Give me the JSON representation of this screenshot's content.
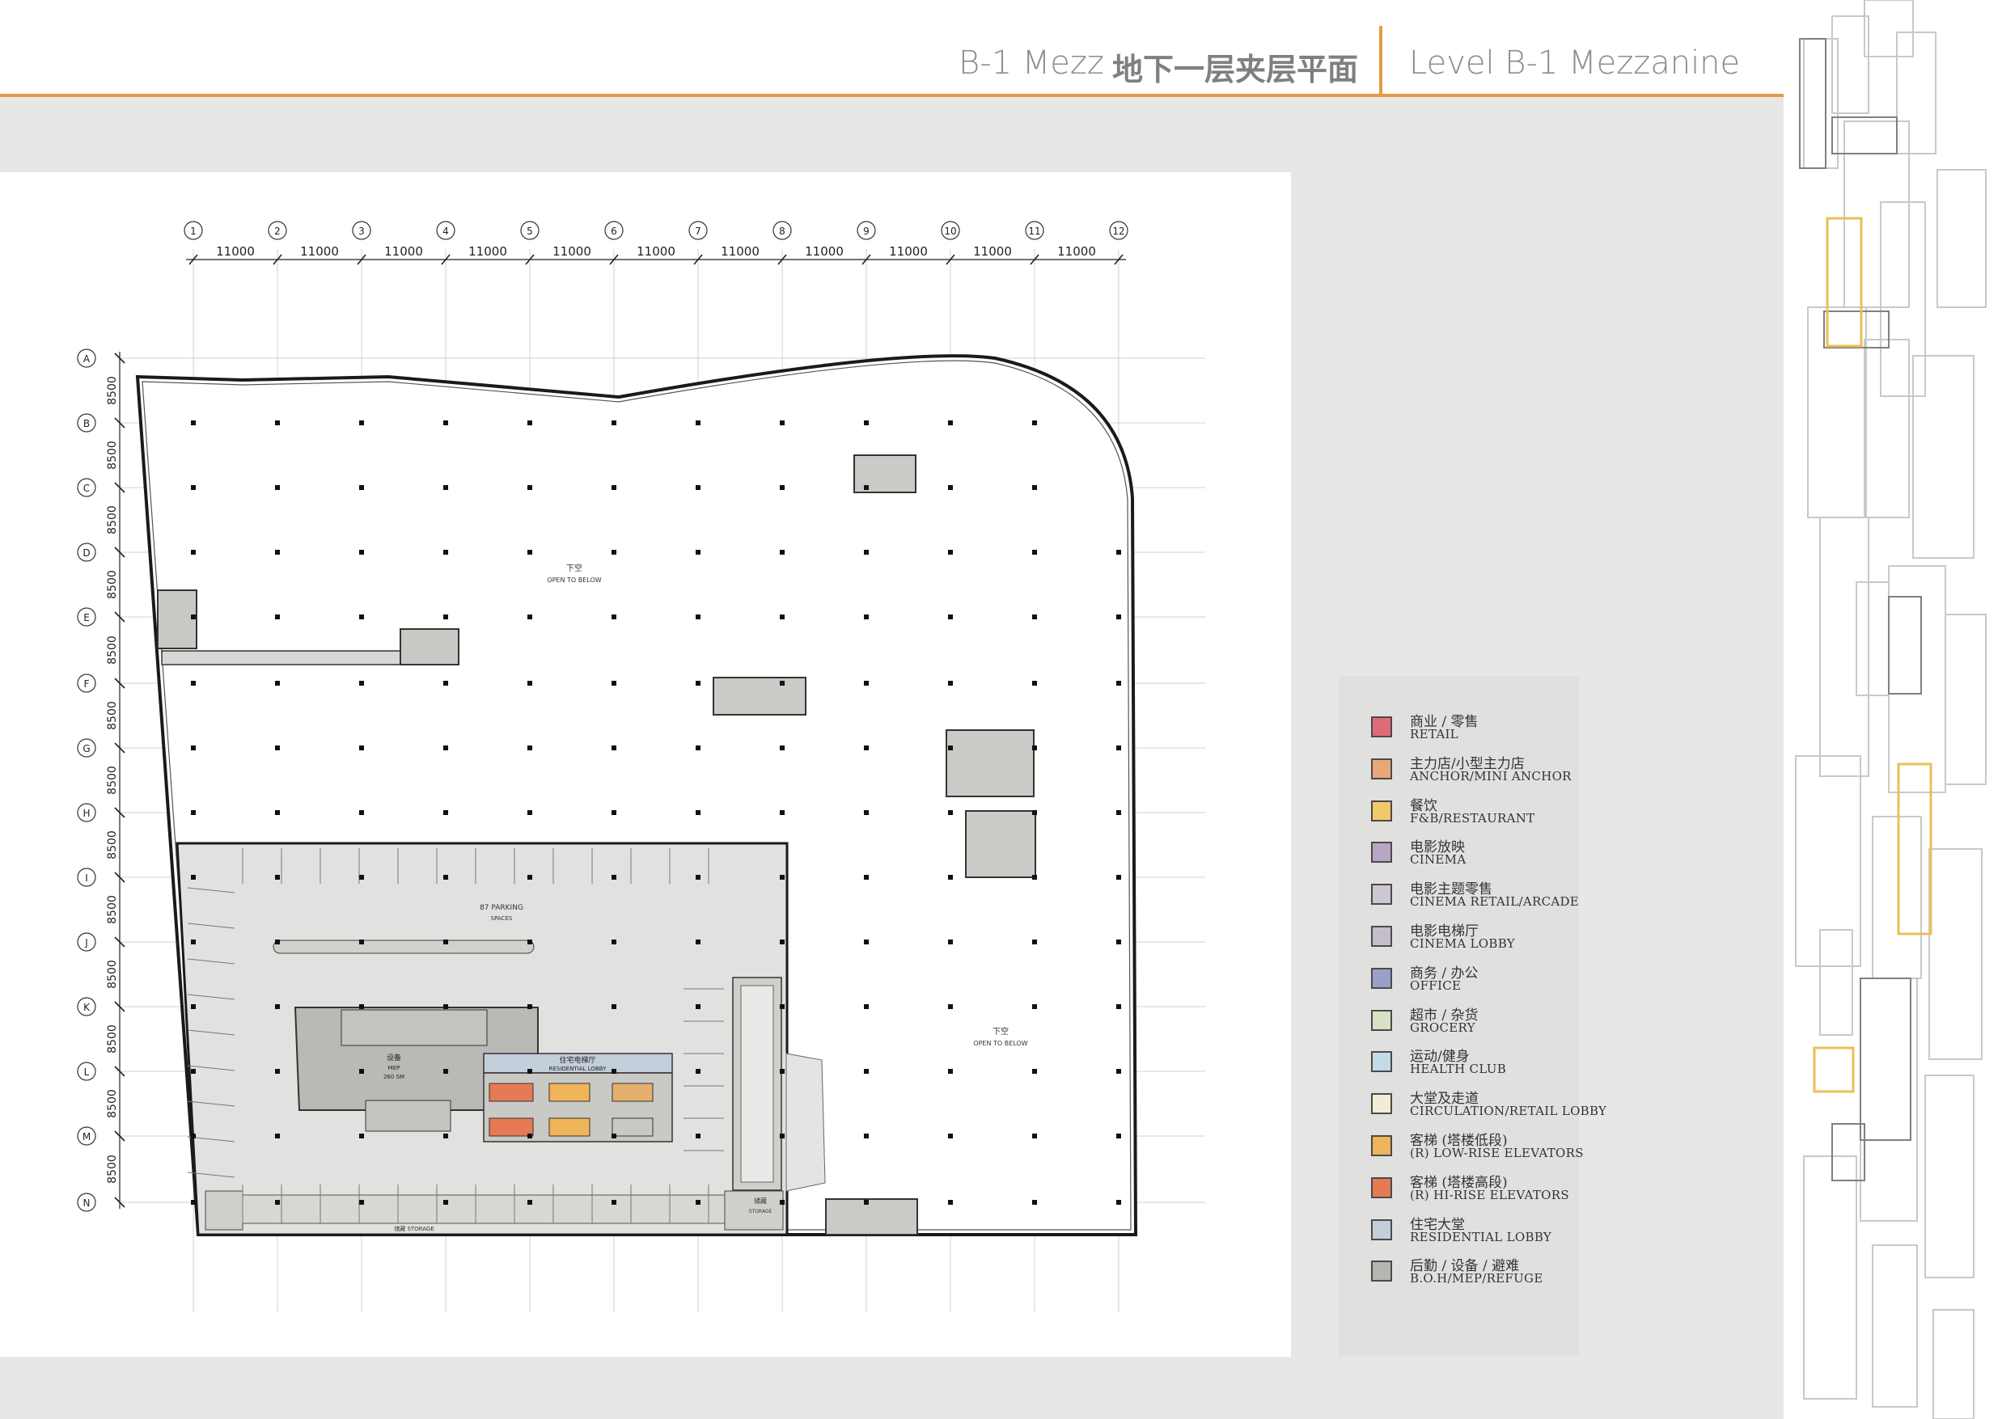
{
  "header": {
    "title_left": "B-1 Mezz",
    "title_cn": "地下一层夹层平面",
    "title_right": "Level B-1 Mezzanine",
    "accent_color": "#e49a45"
  },
  "plan": {
    "column_grid_labels": [
      "1",
      "2",
      "3",
      "4",
      "5",
      "6",
      "7",
      "8",
      "9",
      "10",
      "11",
      "12"
    ],
    "column_spacing_labels": [
      "11000",
      "11000",
      "11000",
      "11000",
      "11000",
      "11000",
      "11000",
      "11000",
      "11000",
      "11000",
      "11000"
    ],
    "row_grid_labels": [
      "A",
      "B",
      "C",
      "D",
      "E",
      "F",
      "G",
      "H",
      "I",
      "J",
      "K",
      "L",
      "M",
      "N"
    ],
    "row_spacing_labels": [
      "8500",
      "8500",
      "8500",
      "8500",
      "8500",
      "8500",
      "8500",
      "8500",
      "8500",
      "8500",
      "8500",
      "8500",
      "8500"
    ],
    "open_below_1_cn": "下空",
    "open_below_1_en": "OPEN TO BELOW",
    "open_below_2_cn": "下空",
    "open_below_2_en": "OPEN TO BELOW",
    "parking_label": "87 PARKING",
    "parking_sub": "SPACES",
    "mep_cn": "设备",
    "mep_en": "MEP",
    "mep_area": "260 SM",
    "res_lobby_cn": "住宅电梯厅",
    "res_lobby_en": "RESIDENTIAL LOBBY",
    "storage_left": "储藏   STORAGE",
    "storage_right_cn": "储藏",
    "storage_right_en": "STORAGE",
    "line_color": "#1a1a1a"
  },
  "legend": [
    {
      "cn": "商业 / 零售",
      "en": "RETAIL",
      "color": "#e06b78"
    },
    {
      "cn": "主力店/小型主力店",
      "en": "ANCHOR/MINI ANCHOR",
      "color": "#e9a877"
    },
    {
      "cn": "餐饮",
      "en": "F&B/RESTAURANT",
      "color": "#f1c86a"
    },
    {
      "cn": "电影放映",
      "en": "CINEMA",
      "color": "#b8a6c4"
    },
    {
      "cn": "电影主题零售",
      "en": "CINEMA RETAIL/ARCADE",
      "color": "#cdc6d3"
    },
    {
      "cn": "电影电梯厅",
      "en": "CINEMA LOBBY",
      "color": "#c5bdcb"
    },
    {
      "cn": "商务 / 办公",
      "en": "OFFICE",
      "color": "#9aa0c9"
    },
    {
      "cn": "超市 / 杂货",
      "en": "GROCERY",
      "color": "#d7e2c2"
    },
    {
      "cn": "运动/健身",
      "en": "HEALTH CLUB",
      "color": "#c3dbe6"
    },
    {
      "cn": "大堂及走道",
      "en": "CIRCULATION/RETAIL LOBBY",
      "color": "#f3ebd2"
    },
    {
      "cn": "客梯 (塔楼低段)",
      "en": "(R) LOW-RISE ELEVATORS",
      "color": "#f0b45a"
    },
    {
      "cn": "客梯 (塔楼高段)",
      "en": "(R) HI-RISE ELEVATORS",
      "color": "#e67a55"
    },
    {
      "cn": "住宅大堂",
      "en": "RESIDENTIAL LOBBY",
      "color": "#c3cedb"
    },
    {
      "cn": "后勤 / 设备 / 避难",
      "en": "B.O.H/MEP/REFUGE",
      "color": "#b5b5b1"
    }
  ]
}
